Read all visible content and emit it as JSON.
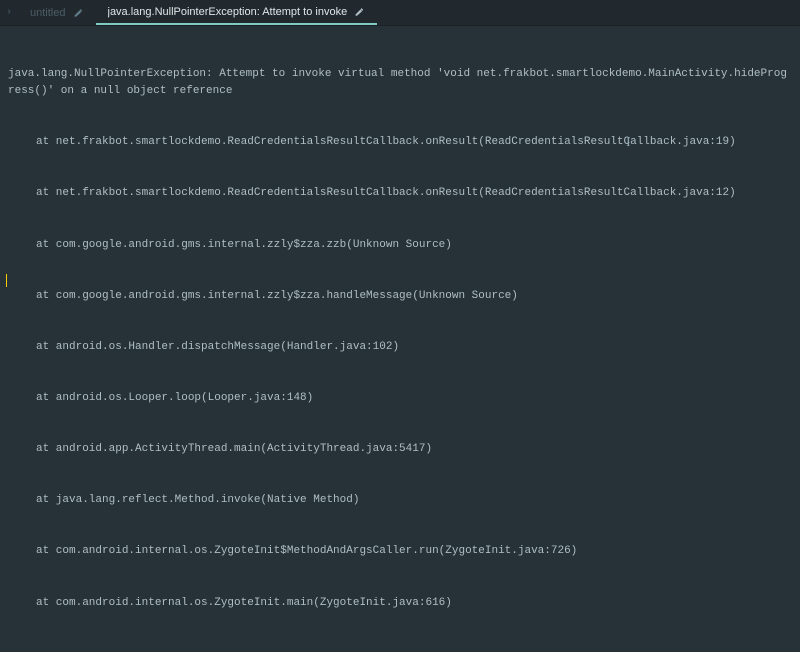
{
  "tabs": [
    {
      "title": "untitled"
    },
    {
      "title": "java.lang.NullPointerException: Attempt to invoke"
    }
  ],
  "content": {
    "header_line": "java.lang.NullPointerException: Attempt to invoke virtual method 'void net.frakbot.smartlockdemo.MainActivity.hideProgress()' on a null object reference",
    "stack": [
      "at net.frakbot.smartlockdemo.ReadCredentialsResultCallback.onResult(ReadCredentialsResultCallback.java:19)",
      "at net.frakbot.smartlockdemo.ReadCredentialsResultCallback.onResult(ReadCredentialsResultCallback.java:12)",
      "at com.google.android.gms.internal.zzly$zza.zzb(Unknown Source)",
      "at com.google.android.gms.internal.zzly$zza.handleMessage(Unknown Source)",
      "at android.os.Handler.dispatchMessage(Handler.java:102)",
      "at android.os.Looper.loop(Looper.java:148)",
      "at android.app.ActivityThread.main(ActivityThread.java:5417)",
      "at java.lang.reflect.Method.invoke(Native Method)",
      "at com.android.internal.os.ZygoteInit$MethodAndArgsCaller.run(ZygoteInit.java:726)",
      "at com.android.internal.os.ZygoteInit.main(ZygoteInit.java:616)"
    ]
  }
}
